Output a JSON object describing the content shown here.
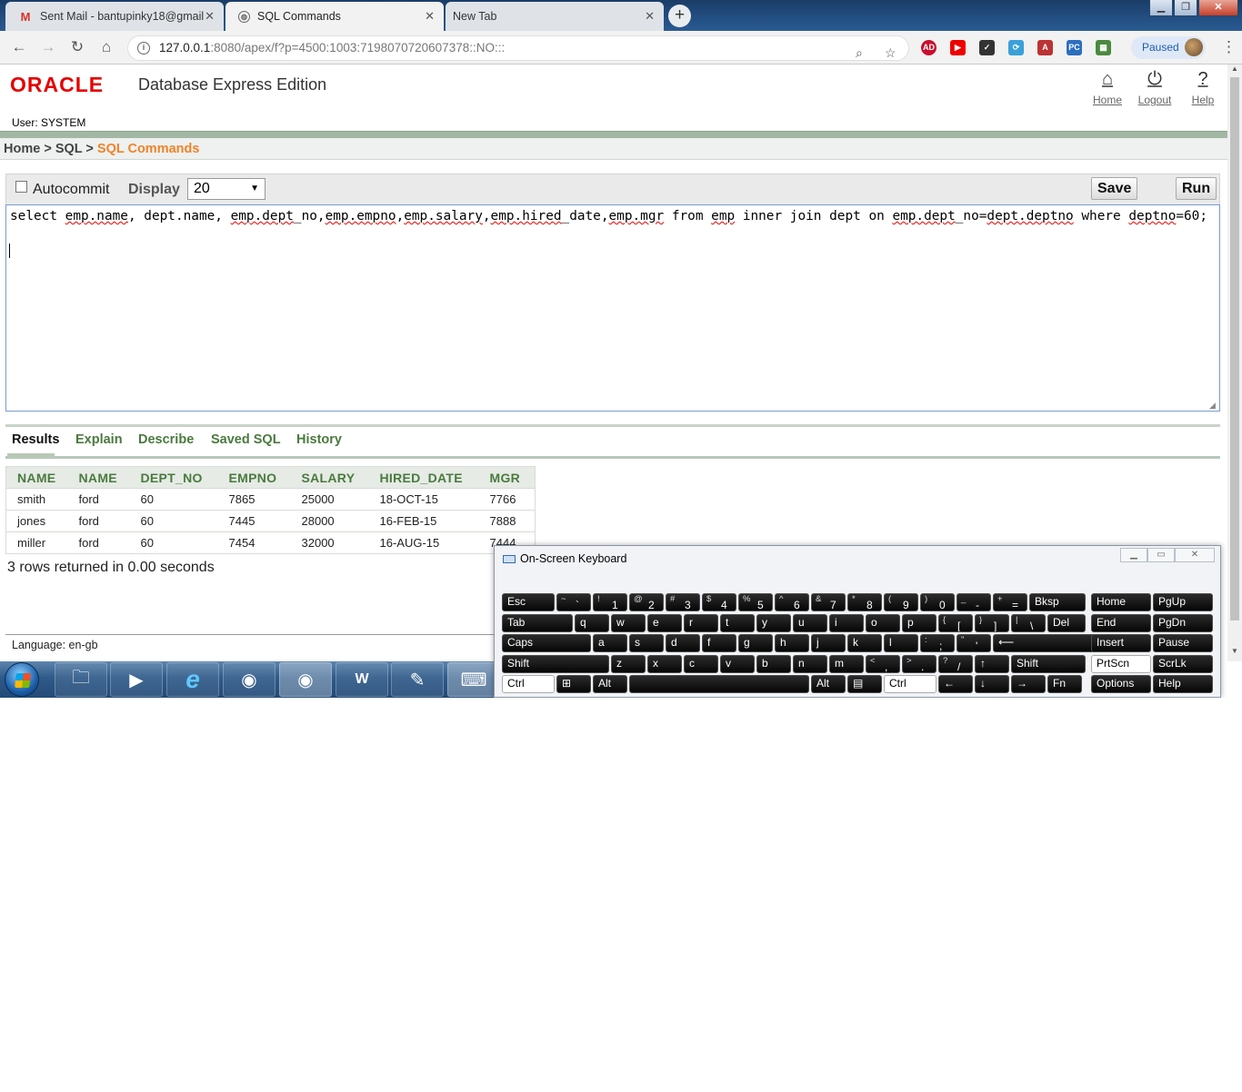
{
  "browser": {
    "tabs": [
      {
        "title": "Sent Mail - bantupinky18@gmail",
        "icon": "gmail-icon"
      },
      {
        "title": "SQL Commands",
        "icon": "globe-icon"
      },
      {
        "title": "New Tab",
        "icon": ""
      }
    ],
    "url_host": "127.0.0.1",
    "url_rest": ":8080/apex/f?p=4500:1003:7198070720607378::NO:::",
    "paused_label": "Paused"
  },
  "header": {
    "logo": "ORACLE",
    "product": "Database Express Edition",
    "links": {
      "home": "Home",
      "logout": "Logout",
      "help": "Help"
    },
    "user": "User: SYSTEM"
  },
  "breadcrumb": {
    "home": "Home",
    "sql": "SQL",
    "current": "SQL Commands",
    "sep": ">"
  },
  "command_bar": {
    "autocommit_label": "Autocommit",
    "display_label": "Display",
    "display_value": "20",
    "save_label": "Save",
    "run_label": "Run"
  },
  "editor": {
    "parts": [
      "select ",
      "emp.name",
      ", dept.name, ",
      "emp.dept",
      "_no,",
      "emp.empno",
      ",",
      "emp.salary",
      ",",
      "emp.hired",
      "_date,",
      "emp.mgr",
      " from ",
      "emp",
      " inner join dept on ",
      "emp.dept",
      "_no=",
      "dept.deptno",
      " where ",
      "deptno",
      "=60;"
    ]
  },
  "result_tabs": [
    "Results",
    "Explain",
    "Describe",
    "Saved SQL",
    "History"
  ],
  "results": {
    "columns": [
      "NAME",
      "NAME",
      "DEPT_NO",
      "EMPNO",
      "SALARY",
      "HIRED_DATE",
      "MGR"
    ],
    "rows": [
      [
        "smith",
        "ford",
        "60",
        "7865",
        "25000",
        "18-OCT-15",
        "7766"
      ],
      [
        "jones",
        "ford",
        "60",
        "7445",
        "28000",
        "16-FEB-15",
        "7888"
      ],
      [
        "miller",
        "ford",
        "60",
        "7454",
        "32000",
        "16-AUG-15",
        "7444"
      ]
    ],
    "summary": "3 rows returned in 0.00 seconds"
  },
  "footer": {
    "language": "Language: en-gb"
  },
  "osk": {
    "title": "On-Screen Keyboard",
    "rows": [
      [
        "Esc",
        "~ `",
        "! 1",
        "@ 2",
        "# 3",
        "$ 4",
        "% 5",
        "^ 6",
        "& 7",
        "* 8",
        "( 9",
        ") 0",
        "_ -",
        "+ =",
        "Bksp",
        "Home",
        "PgUp"
      ],
      [
        "Tab",
        "q",
        "w",
        "e",
        "r",
        "t",
        "y",
        "u",
        "i",
        "o",
        "p",
        "{ [",
        "} ]",
        "| \\",
        "Del",
        "End",
        "PgDn"
      ],
      [
        "Caps",
        "a",
        "s",
        "d",
        "f",
        "g",
        "h",
        "j",
        "k",
        "l",
        ": ;",
        "\" '",
        "⟵",
        "Insert",
        "Pause"
      ],
      [
        "Shift",
        "z",
        "x",
        "c",
        "v",
        "b",
        "n",
        "m",
        "< ,",
        "> .",
        "? /",
        "↑",
        "Shift",
        "PrtScn",
        "ScrLk"
      ],
      [
        "Ctrl",
        "⊞",
        "Alt",
        "",
        "Alt",
        "▤",
        "Ctrl",
        "←",
        "↓",
        "→",
        "Fn",
        "Options",
        "Help"
      ]
    ]
  }
}
